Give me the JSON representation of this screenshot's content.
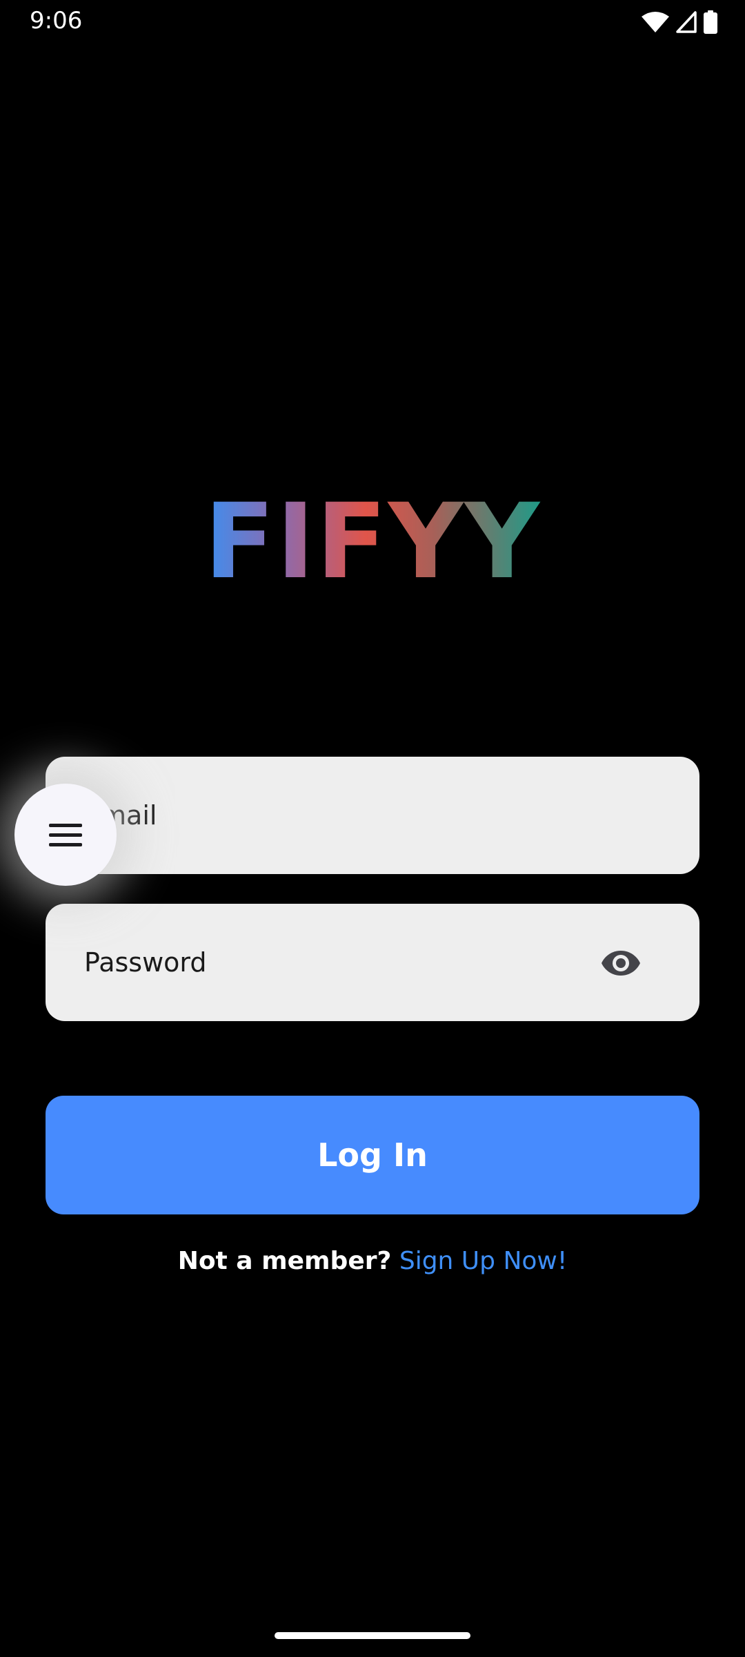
{
  "status_bar": {
    "time": "9:06",
    "icons": [
      "wifi-icon",
      "cellular-signal-icon",
      "battery-icon"
    ]
  },
  "logo": {
    "text": "FIFYY"
  },
  "form": {
    "email_placeholder": "Email",
    "password_placeholder": "Password",
    "login_label": "Log In",
    "signup_prompt": "Not a member?",
    "signup_link": "Sign Up Now!"
  },
  "fab": {
    "icon": "menu-icon"
  },
  "colors": {
    "background": "#000000",
    "field_background": "#eeeeee",
    "primary_button": "#478bfe",
    "link": "#3f8ff7",
    "logo_gradient": [
      "#3d8ff0",
      "#8a6bb0",
      "#e0554a",
      "#a86058",
      "#1f9b88"
    ]
  }
}
